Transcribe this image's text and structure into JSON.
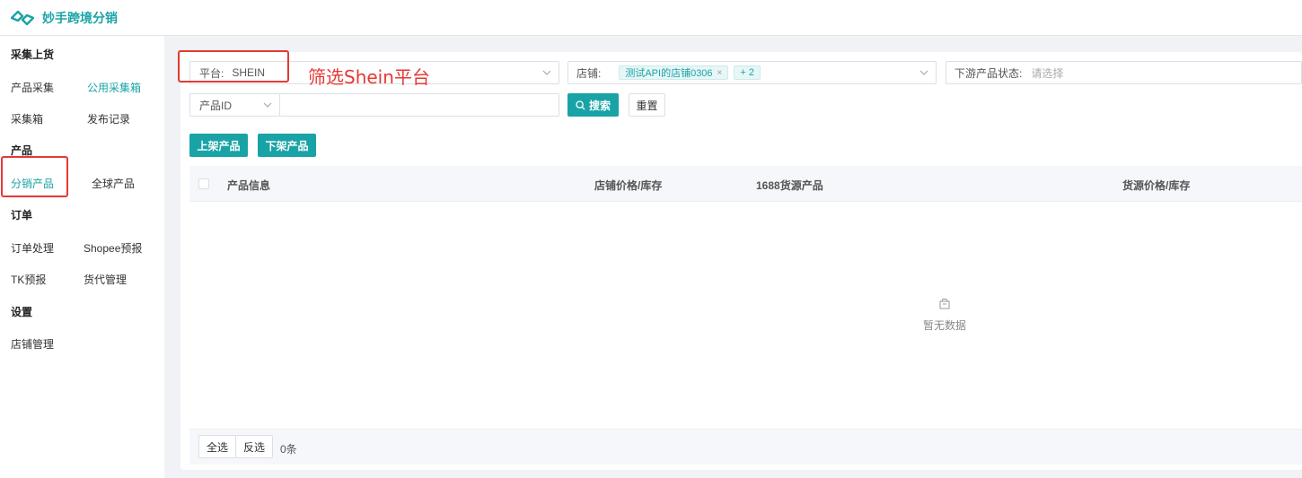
{
  "app": {
    "title": "妙手跨境分销"
  },
  "sidebar": {
    "sections": [
      {
        "title": "采集上货",
        "items": [
          {
            "label": "产品采集",
            "active": false
          },
          {
            "label": "公用采集箱",
            "active": true
          },
          {
            "label": "采集箱",
            "active": false
          },
          {
            "label": "发布记录",
            "active": false
          }
        ]
      },
      {
        "title": "产品",
        "items": [
          {
            "label": "分销产品",
            "active": true
          },
          {
            "label": "全球产品",
            "active": false
          }
        ]
      },
      {
        "title": "订单",
        "items": [
          {
            "label": "订单处理",
            "active": false
          },
          {
            "label": "Shopee预报",
            "active": false
          },
          {
            "label": "TK预报",
            "active": false
          },
          {
            "label": "货代管理",
            "active": false
          }
        ]
      },
      {
        "title": "设置",
        "items": [
          {
            "label": "店铺管理",
            "active": false
          }
        ]
      }
    ]
  },
  "filters": {
    "platform": {
      "label": "平台:",
      "value": "SHEIN"
    },
    "store": {
      "label": "店铺:",
      "tags": [
        "测试API的店铺0306"
      ],
      "more": "+ 2"
    },
    "downstream_status": {
      "label": "下游产品状态:",
      "placeholder": "请选择"
    },
    "id_type": {
      "value": "产品ID"
    },
    "id_input": {
      "placeholder": ""
    },
    "search_label": "搜索",
    "reset_label": "重置"
  },
  "actions": {
    "list_label": "上架产品",
    "delist_label": "下架产品"
  },
  "table": {
    "columns": [
      "产品信息",
      "店铺价格/库存",
      "1688货源产品",
      "货源价格/库存"
    ],
    "empty_text": "暂无数据"
  },
  "footer": {
    "select_all": "全选",
    "invert": "反选",
    "count": "0条"
  },
  "annotation": {
    "text": "筛选Shein平台"
  },
  "colors": {
    "accent": "#1aa3a6",
    "highlight": "#e53935"
  }
}
